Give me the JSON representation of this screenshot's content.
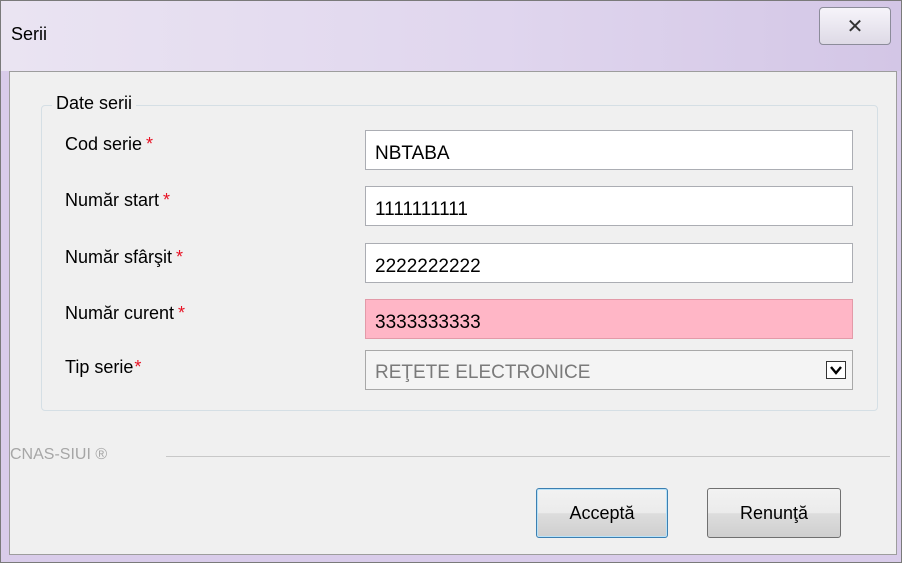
{
  "window": {
    "title": "Serii",
    "close_glyph": "✕"
  },
  "group": {
    "title": "Date serii"
  },
  "fields": [
    {
      "label": "Cod serie",
      "required_mark": "*",
      "value": "NBTABA"
    },
    {
      "label": "Număr start",
      "required_mark": "*",
      "value": "1111111111"
    },
    {
      "label": "Număr sfârşit",
      "required_mark": "*",
      "value": "2222222222"
    },
    {
      "label": "Număr curent",
      "required_mark": "*",
      "value": "3333333333",
      "state": "error"
    }
  ],
  "tip_serie": {
    "label": "Tip serie",
    "required_mark": "*",
    "selected": "REŢETE ELECTRONICE"
  },
  "footer": {
    "brand": "CNAS-SIUI ®"
  },
  "buttons": {
    "accept": "Acceptă",
    "cancel": "Renunţă"
  },
  "colors": {
    "required": "#e81123",
    "error_field": "#ffb6c6",
    "title_bar": "#e0d6ee"
  },
  "icons": {
    "close": "close-icon",
    "dropdown": "chevron-down-icon"
  }
}
